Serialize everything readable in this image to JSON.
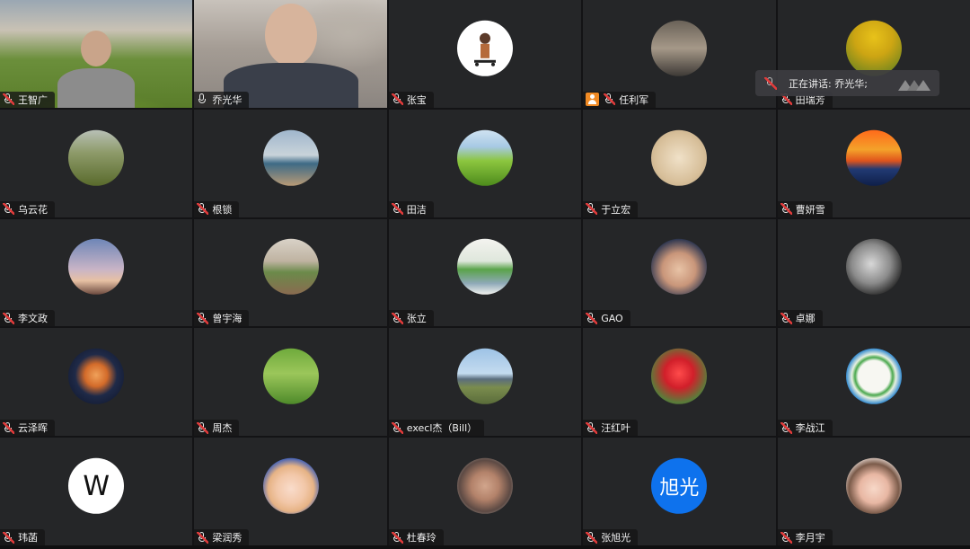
{
  "participants": [
    {
      "name": "王智广",
      "speaking": false,
      "host": false
    },
    {
      "name": "乔光华",
      "speaking": true,
      "host": false
    },
    {
      "name": "张宝",
      "speaking": false,
      "host": false
    },
    {
      "name": "任利军",
      "speaking": false,
      "host": true
    },
    {
      "name": "田瑞芳",
      "speaking": false,
      "host": false
    },
    {
      "name": "乌云花",
      "speaking": false,
      "host": false
    },
    {
      "name": "根锁",
      "speaking": false,
      "host": false
    },
    {
      "name": "田洁",
      "speaking": false,
      "host": false
    },
    {
      "name": "于立宏",
      "speaking": false,
      "host": false
    },
    {
      "name": "曹妍雪",
      "speaking": false,
      "host": false
    },
    {
      "name": "李文政",
      "speaking": false,
      "host": false
    },
    {
      "name": "曾宇海",
      "speaking": false,
      "host": false
    },
    {
      "name": "张立",
      "speaking": false,
      "host": false
    },
    {
      "name": "GAO",
      "speaking": false,
      "host": false
    },
    {
      "name": "卓娜",
      "speaking": false,
      "host": false
    },
    {
      "name": "云泽晖",
      "speaking": false,
      "host": false
    },
    {
      "name": "周杰",
      "speaking": false,
      "host": false
    },
    {
      "name": "execl杰（Bill）",
      "speaking": false,
      "host": false
    },
    {
      "name": "汪红叶",
      "speaking": false,
      "host": false
    },
    {
      "name": "李战江",
      "speaking": false,
      "host": false
    },
    {
      "name": "玮菡",
      "speaking": false,
      "host": false
    },
    {
      "name": "梁润秀",
      "speaking": false,
      "host": false
    },
    {
      "name": "杜春玲",
      "speaking": false,
      "host": false
    },
    {
      "name": "张旭光",
      "speaking": false,
      "host": false
    },
    {
      "name": "李月宇",
      "speaking": false,
      "host": false
    }
  ],
  "avatar_text": {
    "wei_han": "W",
    "zhang_xuguang": "旭光"
  },
  "talking_indicator": {
    "text": "正在讲话: 乔光华;"
  },
  "colors": {
    "speaking_border": "#2bbf5a",
    "muted_icon": "#e23b3b",
    "host_badge": "#f08a24",
    "tile_bg": "#252628",
    "avatar_blue": "#0e72ed"
  }
}
